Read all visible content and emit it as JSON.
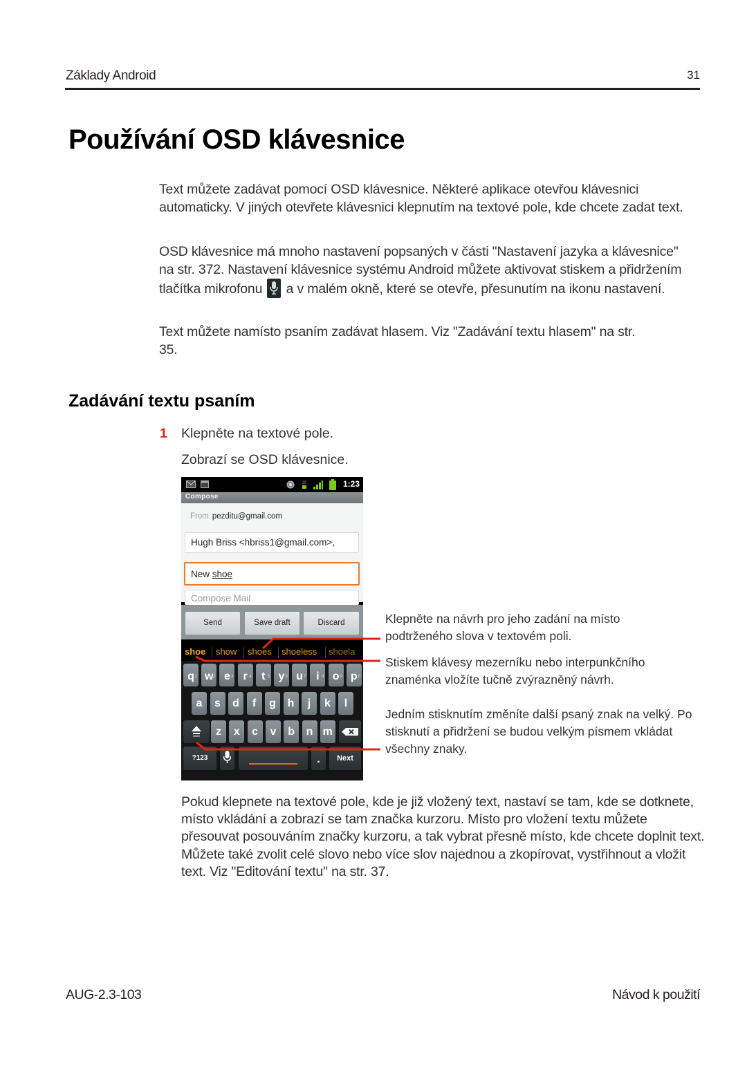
{
  "header": {
    "running_title": "Základy Android",
    "page_number": "31"
  },
  "page_title": "Používání OSD klávesnice",
  "intro_paragraphs": [
    "Text můžete zadávat pomocí OSD klávesnice. Některé aplikace otevřou klávesnici automaticky. V jiných otevřete klávesnici klepnutím na textové pole, kde chcete zadat text.",
    {
      "before_icon": "OSD klávesnice má mnoho nastavení popsaných v části \"Nastavení jazyka a klávesnice\" na str. 372. Nastavení klávesnice systému Android můžete aktivovat stiskem a přidržením tlačítka mikrofonu",
      "icon": "microphone-icon",
      "after_icon": "a v malém okně, které se otevře, přesunutím na ikonu nastavení."
    },
    "Text můžete namísto psaním zadávat hlasem. Viz \"Zadávání textu hlasem\" na str. 35."
  ],
  "section": {
    "title": "Zadávání textu psaním",
    "steps": [
      {
        "number": "1",
        "text": "Klepněte na textové pole.",
        "result": "Zobrazí se OSD klávesnice."
      }
    ]
  },
  "phone": {
    "status_bar": {
      "time": "1:23",
      "left_icons": [
        "gmail-icon",
        "calendar-icon"
      ],
      "right_icons": [
        "gps-icon",
        "data-3g-icon",
        "signal-icon",
        "battery-icon"
      ]
    },
    "title": "Compose",
    "from_label": "From",
    "from_value": "pezditu@gmail.com",
    "to_value": "Hugh Briss <hbriss1@gmail.com>,",
    "subject_prefix": "New ",
    "subject_underlined": "shoe",
    "body_placeholder": "Compose Mail",
    "buttons": [
      "Send",
      "Save draft",
      "Discard"
    ],
    "suggestions": [
      "shoe",
      "show",
      "shoes",
      "shoeless",
      "shoela"
    ],
    "keyboard": {
      "row1": [
        [
          "q",
          "1"
        ],
        [
          "w",
          "2"
        ],
        [
          "e",
          "3"
        ],
        [
          "r",
          "4"
        ],
        [
          "t",
          "5"
        ],
        [
          "y",
          "6"
        ],
        [
          "u",
          "7"
        ],
        [
          "i",
          "8"
        ],
        [
          "o",
          "9"
        ],
        [
          "p",
          "0"
        ]
      ],
      "row2": [
        "a",
        "s",
        "d",
        "f",
        "g",
        "h",
        "j",
        "k",
        "l"
      ],
      "row3": [
        "z",
        "x",
        "c",
        "v",
        "b",
        "n",
        "m"
      ],
      "symbols_key": "?123",
      "period_key": ".",
      "next_key": "Next"
    }
  },
  "callouts": [
    "Klepněte na návrh pro jeho zadání na místo podtrženého slova v textovém poli.",
    "Stiskem klávesy mezerníku nebo interpunkčního znaménka vložíte tučně zvýrazněný návrh.",
    "Jedním stisknutím změníte další psaný znak na velký. Po stisknutí a přidržení se budou velkým písmem vkládat všechny znaky."
  ],
  "bottom_paragraph": "Pokud klepnete na textové pole, kde je již vložený text, nastaví se tam, kde se dotknete, místo vkládání a zobrazí se tam značka kurzoru. Místo pro vložení textu můžete přesouvat posouváním značky kurzoru, a tak vybrat přesně místo, kde chcete doplnit text. Můžete také zvolit celé slovo nebo více slov najednou a zkopírovat, vystřihnout a vložit text. Viz \"Editování textu\" na str. 37.",
  "footer": {
    "left": "AUG-2.3-103",
    "right": "Návod k použití"
  },
  "colors": {
    "accent_red": "#e2231a",
    "suggestion_orange": "#f0a818",
    "focus_orange": "#f07b20"
  }
}
